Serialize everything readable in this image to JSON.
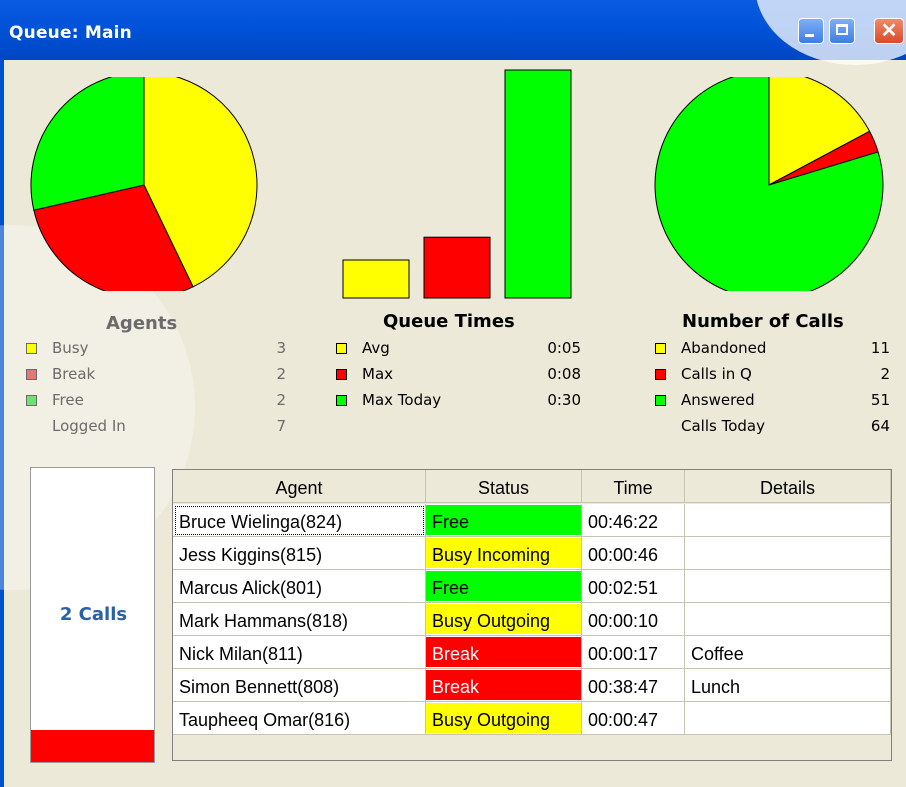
{
  "window": {
    "title": "Queue: Main",
    "controls": {
      "minimize": "minimize",
      "maximize": "maximize",
      "close": "close",
      "close_glyph": "✕"
    }
  },
  "colors": {
    "yellow": "#ffff00",
    "red": "#ff0000",
    "green": "#00ff00",
    "calls_blue": "#2b5fa8",
    "titlebar": "#0052d8"
  },
  "agents": {
    "title": "Agents",
    "rows": [
      {
        "label": "Busy",
        "value": "3",
        "color": "#ffff00"
      },
      {
        "label": "Break",
        "value": "2",
        "color": "#ff0000"
      },
      {
        "label": "Free",
        "value": "2",
        "color": "#00ff00"
      }
    ],
    "total_label": "Logged In",
    "total_value": "7"
  },
  "queue_times": {
    "title": "Queue Times",
    "rows": [
      {
        "label": "Avg",
        "value": "0:05",
        "color": "#ffff00"
      },
      {
        "label": "Max",
        "value": "0:08",
        "color": "#ff0000"
      },
      {
        "label": "Max Today",
        "value": "0:30",
        "color": "#00ff00"
      }
    ]
  },
  "number_of_calls": {
    "title": "Number of Calls",
    "rows": [
      {
        "label": "Abandoned",
        "value": "11",
        "color": "#ffff00"
      },
      {
        "label": "Calls in Q",
        "value": "2",
        "color": "#ff0000"
      },
      {
        "label": "Answered",
        "value": "51",
        "color": "#00ff00"
      }
    ],
    "total_label": "Calls Today",
    "total_value": "64"
  },
  "chart_data": [
    {
      "type": "pie",
      "title": "",
      "categories": [
        "Busy",
        "Break",
        "Free"
      ],
      "values": [
        3,
        2,
        2
      ],
      "colors": [
        "#ffff00",
        "#ff0000",
        "#00ff00"
      ]
    },
    {
      "type": "bar",
      "title": "",
      "categories": [
        "Avg",
        "Max",
        "Max Today"
      ],
      "values": [
        5,
        8,
        30
      ],
      "colors": [
        "#ffff00",
        "#ff0000",
        "#00ff00"
      ],
      "ylim": [
        0,
        30
      ]
    },
    {
      "type": "pie",
      "title": "",
      "categories": [
        "Abandoned",
        "Calls in Q",
        "Answered"
      ],
      "values": [
        11,
        2,
        51
      ],
      "colors": [
        "#ffff00",
        "#ff0000",
        "#00ff00"
      ]
    }
  ],
  "calls_in_queue": {
    "label": "2 Calls",
    "fill_fraction": 0.11
  },
  "agent_table": {
    "columns": [
      "Agent",
      "Status",
      "Time",
      "Details"
    ],
    "rows": [
      {
        "agent": "Bruce Wielinga(824)",
        "status": "Free",
        "status_color": "#00ff00",
        "time": "00:46:22",
        "details": ""
      },
      {
        "agent": "Jess Kiggins(815)",
        "status": "Busy Incoming",
        "status_color": "#ffff00",
        "time": "00:00:46",
        "details": ""
      },
      {
        "agent": "Marcus Alick(801)",
        "status": "Free",
        "status_color": "#00ff00",
        "time": "00:02:51",
        "details": ""
      },
      {
        "agent": "Mark Hammans(818)",
        "status": "Busy Outgoing",
        "status_color": "#ffff00",
        "time": "00:00:10",
        "details": ""
      },
      {
        "agent": "Nick Milan(811)",
        "status": "Break",
        "status_color": "#ff0000",
        "time": "00:00:17",
        "details": "Coffee"
      },
      {
        "agent": "Simon Bennett(808)",
        "status": "Break",
        "status_color": "#ff0000",
        "time": "00:38:47",
        "details": "Lunch"
      },
      {
        "agent": "Taupheeq Omar(816)",
        "status": "Busy Outgoing",
        "status_color": "#ffff00",
        "time": "00:00:47",
        "details": ""
      }
    ]
  }
}
